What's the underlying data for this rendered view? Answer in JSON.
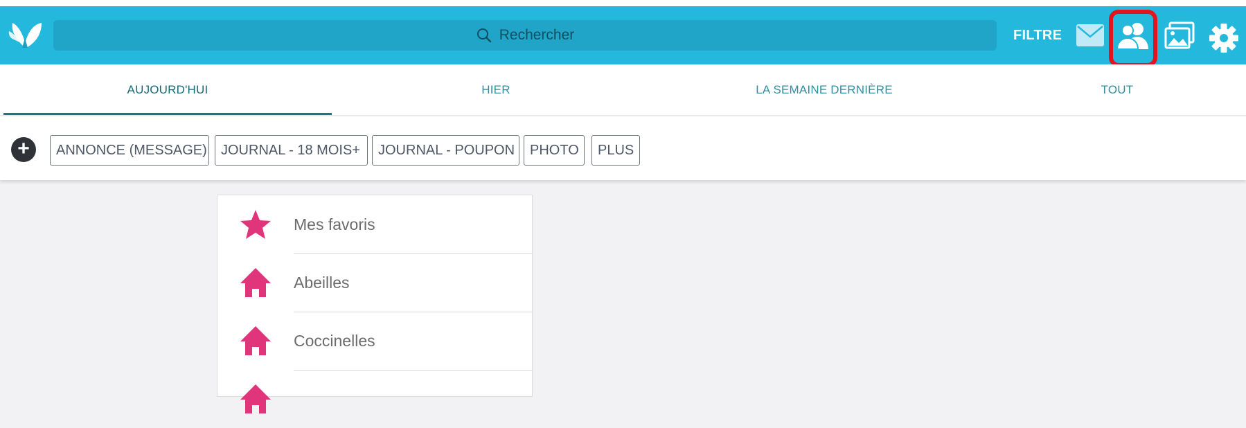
{
  "colors": {
    "topbar": "#24b8dc",
    "search_bg": "#20a5c8",
    "tab_active_underline": "#1c7485",
    "highlight": "#e3141f",
    "accent_pink": "#e0357b"
  },
  "header": {
    "logo_icon": "butterfly-logo-icon",
    "search_placeholder": "Rechercher",
    "filter_label": "FILTRE",
    "icons": [
      "mail-icon",
      "people-icon",
      "gallery-icon",
      "gear-icon"
    ]
  },
  "tabs": [
    {
      "label": "AUJOURD'HUI",
      "active": true
    },
    {
      "label": "HIER",
      "active": false
    },
    {
      "label": "LA SEMAINE DERNIÈRE",
      "active": false
    },
    {
      "label": "TOUT",
      "active": false
    }
  ],
  "actions": {
    "add_icon": "plus-circle-icon",
    "chips": [
      "ANNONCE (MESSAGE)",
      "JOURNAL - 18 MOIS+",
      "JOURNAL - POUPON",
      "PHOTO",
      "PLUS"
    ]
  },
  "groups": [
    {
      "label": "Mes favoris",
      "icon": "star-icon"
    },
    {
      "label": "Abeilles",
      "icon": "home-icon"
    },
    {
      "label": "Coccinelles",
      "icon": "home-icon"
    }
  ]
}
